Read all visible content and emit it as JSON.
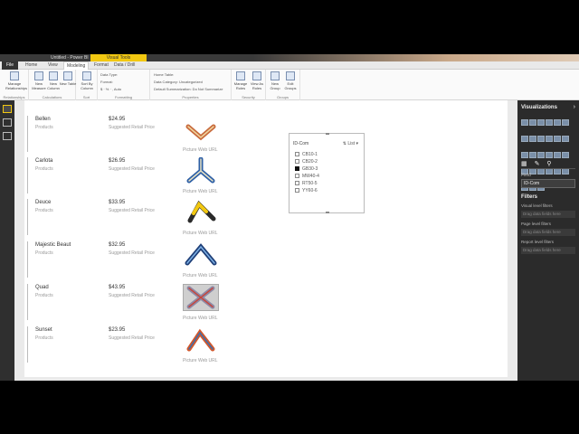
{
  "window": {
    "title": "Untitled - Power BI",
    "context_tab": "Visual Tools"
  },
  "tabs": [
    "File",
    "Home",
    "View",
    "Modeling",
    "Format",
    "Data / Drill"
  ],
  "ribbon": {
    "groups": [
      {
        "label": "Relationships",
        "buttons": [
          "Manage Relationships"
        ]
      },
      {
        "label": "Calculations",
        "buttons": [
          "New Measure",
          "New Column",
          "New Table"
        ]
      },
      {
        "label": "Sort",
        "buttons": [
          "Sort By Column"
        ]
      },
      {
        "label": "Formatting",
        "lines": [
          "Data Type:",
          "Format:",
          "$ · % · ,   Auto"
        ]
      },
      {
        "label": "Properties",
        "lines": [
          "Home Table:",
          "Data Category: Uncategorized",
          "Default Summarization: Do Not Summarize"
        ]
      },
      {
        "label": "Security",
        "buttons": [
          "Manage Roles",
          "View As Roles"
        ]
      },
      {
        "label": "Groups",
        "buttons": [
          "New Group",
          "Edit Groups"
        ]
      }
    ]
  },
  "products": [
    {
      "name": "Bellen",
      "category": "Products",
      "price": "$24.95",
      "price_label": "Suggested Retail Price",
      "url_label": "Picture Web URL"
    },
    {
      "name": "Carlota",
      "category": "Products",
      "price": "$26.95",
      "price_label": "Suggested Retail Price",
      "url_label": "Picture Web URL"
    },
    {
      "name": "Deuce",
      "category": "Products",
      "price": "$33.95",
      "price_label": "Suggested Retail Price",
      "url_label": "Picture Web URL"
    },
    {
      "name": "Majestic Beaut",
      "category": "Products",
      "price": "$32.95",
      "price_label": "Suggested Retail Price",
      "url_label": "Picture Web URL"
    },
    {
      "name": "Quad",
      "category": "Products",
      "price": "$43.95",
      "price_label": "Suggested Retail Price",
      "url_label": "Picture Web URL"
    },
    {
      "name": "Sunset",
      "category": "Products",
      "price": "$23.95",
      "price_label": "Suggested Retail Price",
      "url_label": "Picture Web URL"
    }
  ],
  "slicer": {
    "header": "ID-Com",
    "mode": "List",
    "items": [
      {
        "label": "CB10-1",
        "checked": false
      },
      {
        "label": "CB20-2",
        "checked": false
      },
      {
        "label": "GB30-3",
        "checked": true
      },
      {
        "label": "MW40-4",
        "checked": false
      },
      {
        "label": "RT50-5",
        "checked": false
      },
      {
        "label": "YY60-6",
        "checked": false
      }
    ]
  },
  "visualizations": {
    "title": "Visualizations",
    "field_label": "Field",
    "field_value": "ID-Com",
    "filters_title": "Filters",
    "filter_sections": [
      {
        "label": "Visual level filters",
        "drop": "Drag data fields here"
      },
      {
        "label": "Page level filters",
        "drop": "Drag data fields here"
      },
      {
        "label": "Report level filters",
        "drop": "Drag data fields here"
      }
    ]
  },
  "colors": {
    "accent": "#f2c811",
    "pane_bg": "#2b2b2b"
  }
}
